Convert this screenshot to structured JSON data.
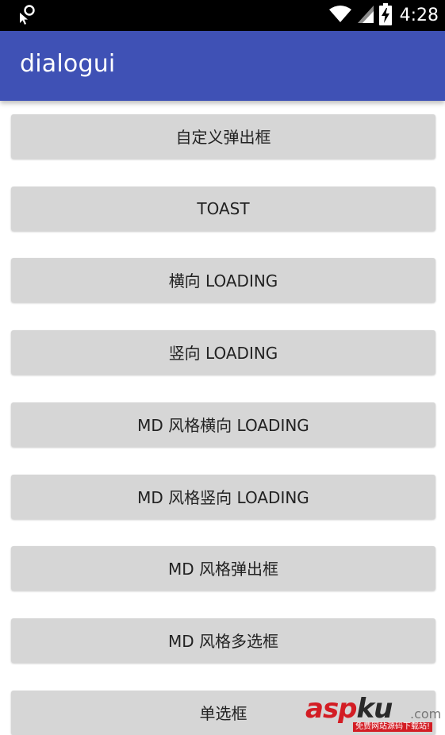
{
  "status_bar": {
    "time": "4:28",
    "icons": [
      "notification-icon",
      "wifi-icon",
      "cellular-icon",
      "battery-charging-icon"
    ]
  },
  "app_bar": {
    "title": "dialogui",
    "color": "#3f51b5"
  },
  "buttons": [
    {
      "label": "自定义弹出框"
    },
    {
      "label": "TOAST"
    },
    {
      "label": "横向 LOADING"
    },
    {
      "label": "竖向 LOADING"
    },
    {
      "label": "MD 风格横向 LOADING"
    },
    {
      "label": "MD 风格竖向 LOADING"
    },
    {
      "label": "MD 风格弹出框"
    },
    {
      "label": "MD 风格多选框"
    },
    {
      "label": "单选框"
    }
  ],
  "watermark": {
    "brand_red": "asp",
    "brand_dark": "ku",
    "brand_suffix": ".com",
    "tagline": "免费网站源码下载站!"
  },
  "colors": {
    "button_bg": "#d6d6d6",
    "status_bar_bg": "#000000",
    "watermark_red": "#d31d24"
  }
}
